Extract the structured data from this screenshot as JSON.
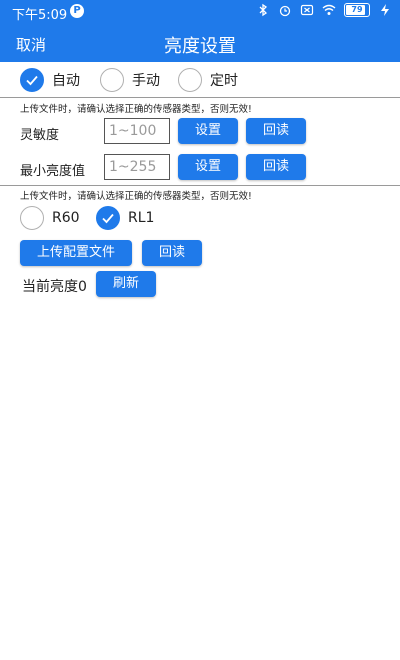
{
  "statusbar": {
    "time": "下午5:09",
    "app_badge": "P",
    "battery": "79"
  },
  "header": {
    "cancel_label": "取消",
    "title": "亮度设置"
  },
  "mode_options": [
    {
      "label": "自动",
      "checked": true
    },
    {
      "label": "手动",
      "checked": false
    },
    {
      "label": "定时",
      "checked": false
    }
  ],
  "notice_text": "上传文件时，请确认选择正确的传感器类型，否则无效!",
  "sensitivity": {
    "label": "灵敏度",
    "placeholder": "1~100",
    "set_label": "设置",
    "read_label": "回读"
  },
  "min_brightness": {
    "label": "最小亮度值",
    "placeholder": "1~255",
    "set_label": "设置",
    "read_label": "回读"
  },
  "notice_text_2": "上传文件时，请确认选择正确的传感器类型，否则无效!",
  "sensor_options": [
    {
      "label": "R60",
      "checked": false
    },
    {
      "label": "RL1",
      "checked": true
    }
  ],
  "upload_config_label": "上传配置文件",
  "upload_read_label": "回读",
  "current_brightness_label": "当前亮度0",
  "refresh_label": "刷新",
  "colors": {
    "accent": "#1f7aea"
  }
}
